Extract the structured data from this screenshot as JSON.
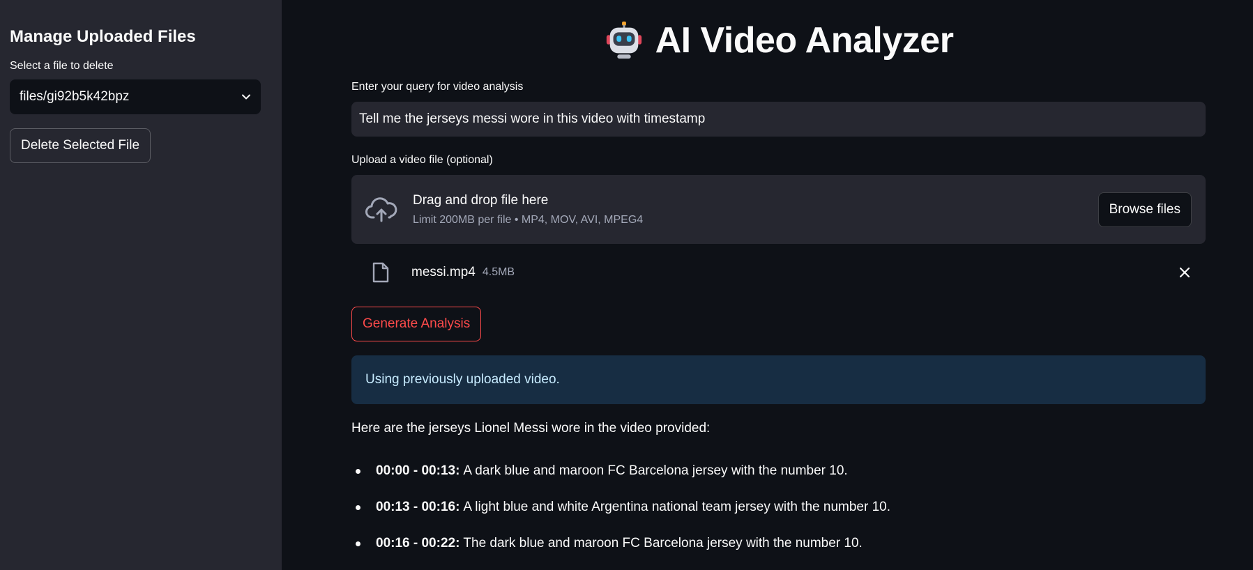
{
  "sidebar": {
    "title": "Manage Uploaded Files",
    "select_label": "Select a file to delete",
    "selected_file": "files/gi92b5k42bpz",
    "delete_button": "Delete Selected File"
  },
  "header": {
    "title": "AI Video Analyzer",
    "emoji_icon": "robot-face-icon"
  },
  "query": {
    "label": "Enter your query for video analysis",
    "value": "Tell me the jerseys messi wore in this video with timestamp"
  },
  "upload": {
    "label": "Upload a video file (optional)",
    "drop_text": "Drag and drop file here",
    "limit_text": "Limit 200MB per file • MP4, MOV, AVI, MPEG4",
    "browse_button": "Browse files",
    "file": {
      "name": "messi.mp4",
      "size": "4.5MB"
    }
  },
  "generate_button": "Generate Analysis",
  "info_message": "Using previously uploaded video.",
  "result": {
    "intro": "Here are the jerseys Lionel Messi wore in the video provided:",
    "items": [
      {
        "time": "00:00 - 00:13:",
        "text": "A dark blue and maroon FC Barcelona jersey with the number 10."
      },
      {
        "time": "00:13 - 00:16:",
        "text": "A light blue and white Argentina national team jersey with the number 10."
      },
      {
        "time": "00:16 - 00:22:",
        "text": "The dark blue and maroon FC Barcelona jersey with the number 10."
      }
    ]
  },
  "colors": {
    "background": "#0e1117",
    "sidebar": "#262730",
    "accent": "#ff4b4b",
    "info_bg": "#172d43",
    "info_text": "#c7ebff"
  }
}
